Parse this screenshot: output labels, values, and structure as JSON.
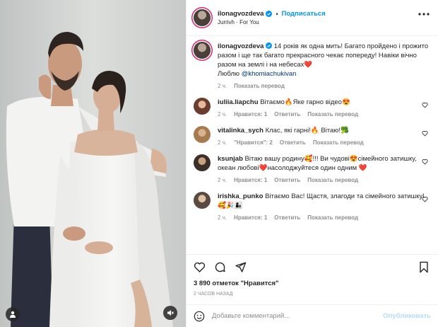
{
  "colors": {
    "accent": "#0095f6",
    "muted": "#8e8e8e",
    "text": "#262626",
    "heart_red": "#ed4956"
  },
  "header": {
    "username": "ilonagvozdeva",
    "dot": "•",
    "follow_label": "Подписаться",
    "subtitle": "Jurrivh · For You",
    "avatar_icon": "avatar-icon",
    "more_icon": "more-horizontal-icon"
  },
  "caption": {
    "username": "ilonagvozdeva",
    "text": "14 років як одна мить! Багато пройдено і прожито разом і ще так багато прекрасного чекає попереду! Навіки вічно разом на землі і на небесах❤️",
    "text2": "Люблю ",
    "mention": "@khomiachukivan",
    "time": "2 ч.",
    "translate": "Показать перевод"
  },
  "comments": [
    {
      "username": "iuliia.liapchu",
      "text": "Вітаємо🔥Яке гарно відео😍",
      "time": "2 ч.",
      "likes": "Нравится: 1",
      "reply": "Ответить",
      "translate": "Показать перевод"
    },
    {
      "username": "vitalinka_sych",
      "text": "Клас, які гарні!🔥 Вітаю!🥦",
      "time": "2 ч.",
      "likes": "\"Нравится\": 2",
      "reply": "Ответить",
      "translate": "Показать перевод"
    },
    {
      "username": "ksunjab",
      "text": "Вітаю вашу родину🥰!!! Ви чудові😍сімейного затишку, океан любові❤️насолоджуйтеся один одним ❤️",
      "time": "2 ч.",
      "likes": "Нравится: 1",
      "reply": "Ответить",
      "translate": "Показать перевод"
    },
    {
      "username": "irishka_punko",
      "text": "Вітаємо Вас! Щастя, злагоди та сімейного затишку!🥰🎉👩‍👦",
      "time": "2 ч.",
      "likes": "Нравится: 1",
      "reply": "Ответить",
      "translate": "Показать перевод"
    }
  ],
  "actions": {
    "like_icon": "heart-icon",
    "comment_icon": "comment-icon",
    "share_icon": "share-icon",
    "save_icon": "bookmark-icon"
  },
  "likes_text": "3 890 отметок \"Нравится\"",
  "time_ago": "2 часов назад",
  "add_comment": {
    "placeholder": "Добавьте комментарий...",
    "publish_label": "Опубликовать",
    "emoji_icon": "emoji-icon"
  },
  "media": {
    "user_icon": "user-tag-icon",
    "sound_icon": "sound-off-icon"
  }
}
